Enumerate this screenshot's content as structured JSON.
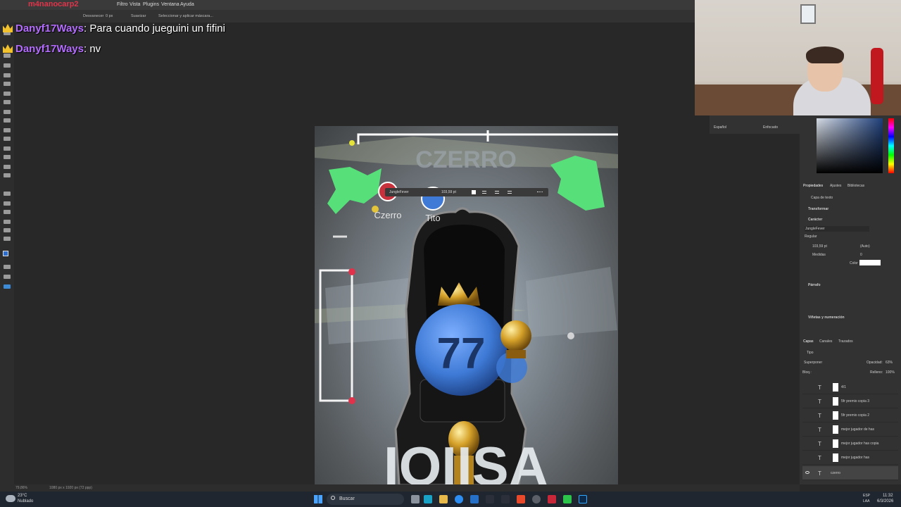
{
  "menu": {
    "items": [
      "Filtro",
      "Vista",
      "Plugins",
      "Ventana",
      "Ayuda"
    ],
    "overlay_text": "m4nanocarp2"
  },
  "options": {
    "invert": "Desvanecer",
    "px": "0 px",
    "smooth": "Suavizar",
    "select_mask": "Seleccionar y aplicar máscara..."
  },
  "chat": [
    {
      "user": "Danyf17Ways",
      "message": "Para cuando jueguini un fifini"
    },
    {
      "user": "Danyf17Ways",
      "message": "nv"
    }
  ],
  "canvas": {
    "top_title": "CZERRO",
    "player1": "Czerro",
    "player2": "Tito",
    "number": "77",
    "bottom_text": "IOIISA",
    "text_toolbar": {
      "font": "JungleFever",
      "size": "103,59 pt"
    }
  },
  "mid": {
    "language": "Español",
    "mode": "Enfocado"
  },
  "properties": {
    "tabs": [
      "Propiedades",
      "Ajustes",
      "Bibliotecas"
    ],
    "layer_type": "Capa de texto",
    "transform": "Transformar",
    "character": "Carácter",
    "font": "JungleFever",
    "style": "Regular",
    "size": "103,59 pt",
    "leading": "(Auto)",
    "tracking_label": "Medidas",
    "tracking": "0",
    "color_label": "Color",
    "paragraph": "Párrafo",
    "bullets": "Viñetas y numeración"
  },
  "layers": {
    "tabs": [
      "Capas",
      "Canales",
      "Trazados"
    ],
    "kind": "Tipo",
    "blend": "Superponer",
    "opacity_label": "Opacidad:",
    "opacity": "63%",
    "lock_label": "Bloq.:",
    "fill_label": "Relleno:",
    "fill": "100%",
    "items": [
      "4/1",
      "5fr premio copia 3",
      "5fr premio copia 2",
      "mejor jugador de has",
      "mejor jugador has copia",
      "mejor jugador has",
      "czerro"
    ]
  },
  "status": {
    "zoom": "79,86%",
    "doc": "1080 px x 1920 px (72 ppp)"
  },
  "taskbar": {
    "weather_temp": "23°C",
    "weather_desc": "Nublado",
    "search": "Buscar",
    "lang1": "ESP",
    "lang2": "LAA",
    "time": "11:32",
    "date": "6/3/2026"
  },
  "colors": {
    "accent_green": "#57e07a",
    "ball_blue": "#3e7ad6",
    "chat_name": "#b46cff"
  }
}
